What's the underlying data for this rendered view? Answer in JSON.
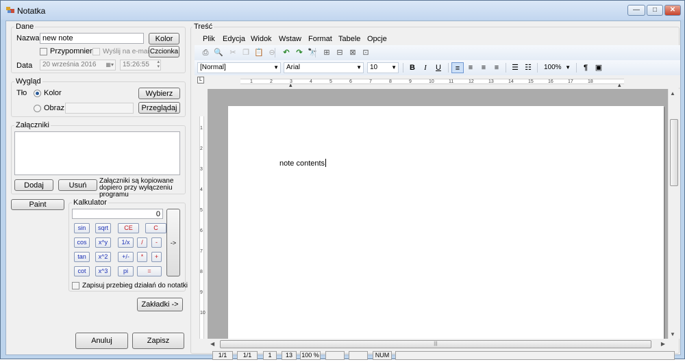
{
  "window": {
    "title": "Notatka",
    "buttons": {
      "minimize": "—",
      "maximize": "□",
      "close": "✕"
    }
  },
  "dane": {
    "caption": "Dane",
    "nazwa_label": "Nazwa",
    "nazwa_value": "new note",
    "kolor_button": "Kolor",
    "przypomnienie_label": "Przypomnienie",
    "wyslij_label": "Wyślij na e-mail",
    "czcionka_button": "Czcionka",
    "data_label": "Data",
    "date_value": "20   września   2016",
    "time_value": "15:26:55"
  },
  "wyglad": {
    "caption": "Wygląd",
    "tlo_label": "Tło",
    "kolor_radio": "Kolor",
    "obraz_radio": "Obraz",
    "wybierz_button": "Wybierz",
    "przegladaj_button": "Przeglądaj"
  },
  "zalaczniki": {
    "caption": "Załączniki",
    "dodaj_button": "Dodaj",
    "usun_button": "Usuń",
    "note": "Załączniki są kopiowane dopiero przy wyłączeniu programu"
  },
  "paint_button": "Paint",
  "kalkulator": {
    "caption": "Kalkulator",
    "display": "0",
    "rows": [
      [
        {
          "t": "sin",
          "c": "blue"
        },
        {
          "t": "sqrt",
          "c": "blue"
        },
        {
          "t": "CE",
          "c": "red"
        },
        {
          "t": "C",
          "c": "red"
        }
      ],
      [
        {
          "t": "cos",
          "c": "blue"
        },
        {
          "t": "x^y",
          "c": "blue"
        },
        {
          "t": "1/x",
          "c": "blue"
        },
        {
          "t": "/",
          "c": "red"
        },
        {
          "t": "-",
          "c": "red"
        }
      ],
      [
        {
          "t": "tan",
          "c": "blue"
        },
        {
          "t": "x^2",
          "c": "blue"
        },
        {
          "t": "+/-",
          "c": "blue"
        },
        {
          "t": "*",
          "c": "red"
        },
        {
          "t": "+",
          "c": "red"
        }
      ],
      [
        {
          "t": "cot",
          "c": "blue"
        },
        {
          "t": "x^3",
          "c": "blue"
        },
        {
          "t": "pi",
          "c": "blue"
        },
        {
          "t": "=",
          "c": "red"
        }
      ]
    ],
    "arrow_button": "->",
    "zapisuj_label": "Zapisuj przebieg działań do notatki"
  },
  "zakladki_button": "Zakładki ->",
  "anuluj_button": "Anuluj",
  "zapisz_button": "Zapisz",
  "tresc": {
    "caption": "Treść",
    "menu": [
      "Plik",
      "Edycja",
      "Widok",
      "Wstaw",
      "Format",
      "Tabele",
      "Opcje"
    ],
    "toolbar_icons": [
      "print-icon",
      "print-preview-icon",
      "cut-icon",
      "copy-icon",
      "paste-icon",
      "delete-icon",
      "undo-icon",
      "redo-icon",
      "find-icon",
      "insert-table-icon",
      "table-delete-icon",
      "table-edit-icon",
      "table-format-icon"
    ],
    "style_value": "[Normal]",
    "font_value": "Arial",
    "size_value": "10",
    "format_buttons": [
      "B",
      "I",
      "U"
    ],
    "zoom_value": "100%",
    "ruler_numbers": [
      "1",
      "2",
      "3",
      "4",
      "5",
      "6",
      "7",
      "8",
      "9",
      "10",
      "11",
      "12",
      "13",
      "14",
      "15",
      "16",
      "17",
      "18"
    ],
    "vruler_numbers": [
      "1",
      "2",
      "3",
      "4",
      "5",
      "6",
      "7",
      "8",
      "9",
      "10"
    ],
    "content": "note contents",
    "status": [
      "1/1",
      "1/1",
      "1",
      "13",
      "100 %",
      "",
      "",
      "NUM",
      ""
    ]
  }
}
